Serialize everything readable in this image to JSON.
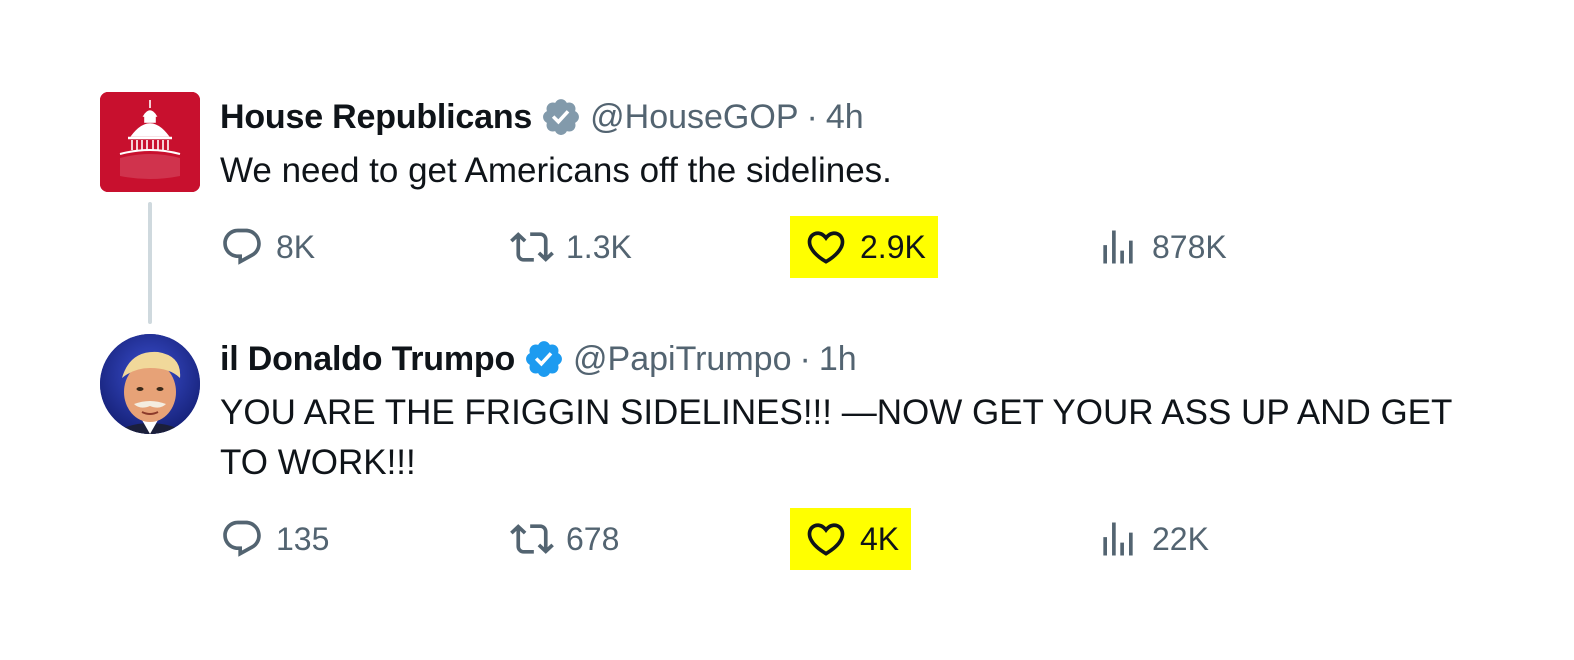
{
  "tweets": [
    {
      "author_name": "House Republicans",
      "handle": "@HouseGOP",
      "separator": "·",
      "time": "4h",
      "text": "We need to get Americans off the sidelines.",
      "badge_color": "#829aab",
      "avatar_logo": "HOUSE GOP capitol-dome logo",
      "avatar_bg": "#c8102e",
      "metrics": {
        "replies": "8K",
        "retweets": "1.3K",
        "likes": "2.9K",
        "views": "878K"
      }
    },
    {
      "author_name": "il Donaldo Trumpo",
      "handle": "@PapiTrumpo",
      "separator": "·",
      "time": "1h",
      "text": "YOU ARE THE FRIGGIN SIDELINES!!! —NOW GET YOUR ASS UP AND GET TO WORK!!!",
      "badge_color": "#1d9bf0",
      "avatar_bg": "#1d2a8c",
      "metrics": {
        "replies": "135",
        "retweets": "678",
        "likes": "4K",
        "views": "22K"
      }
    }
  ],
  "icons": {
    "reply": "reply-bubble-icon",
    "retweet": "retweet-icon",
    "like": "heart-icon",
    "views": "analytics-bars-icon",
    "verified": "verified-badge-icon"
  },
  "highlight_color": "#ffff00"
}
